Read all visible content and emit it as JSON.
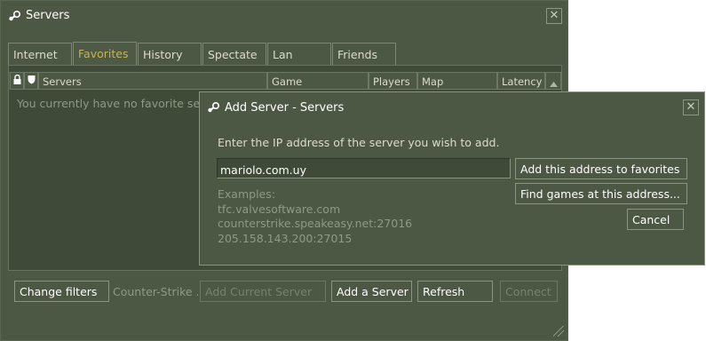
{
  "main_window": {
    "title": "Servers",
    "close_glyph": "✕",
    "logo_icon": "steam-icon",
    "tabs": [
      {
        "label": "Internet",
        "active": false
      },
      {
        "label": "Favorites",
        "active": true
      },
      {
        "label": "History",
        "active": false
      },
      {
        "label": "Spectate",
        "active": false
      },
      {
        "label": "Lan",
        "active": false
      },
      {
        "label": "Friends",
        "active": false
      }
    ],
    "columns": {
      "lock_icon": "lock-icon",
      "shield_icon": "shield-icon",
      "servers": "Servers",
      "game": "Game",
      "players": "Players",
      "map": "Map",
      "latency": "Latency",
      "sort_icon": "sort-ascending-icon"
    },
    "empty_message": "You currently have no favorite servers.",
    "footer": {
      "change_filters": "Change filters",
      "filter_summary": "Counter-Strike ...",
      "add_current_server": "Add Current Server",
      "add_a_server": "Add a Server",
      "refresh": "Refresh",
      "connect": "Connect"
    }
  },
  "dialog": {
    "title": "Add Server - Servers",
    "close_glyph": "✕",
    "logo_icon": "steam-icon",
    "prompt": "Enter the IP address of the server you wish to add.",
    "ip_value": "mariolo.com.uy",
    "examples_heading": "Examples:",
    "examples": [
      "tfc.valvesoftware.com",
      "counterstrike.speakeasy.net:27016",
      "205.158.143.200:27015"
    ],
    "add_to_favorites": "Add this address to favorites",
    "find_games": "Find games at this address...",
    "cancel": "Cancel"
  },
  "colors": {
    "window_bg": "#4c5844",
    "panel_bg": "#3f4a38",
    "active_tab_text": "#c4b454",
    "muted_text": "#8f9984"
  }
}
